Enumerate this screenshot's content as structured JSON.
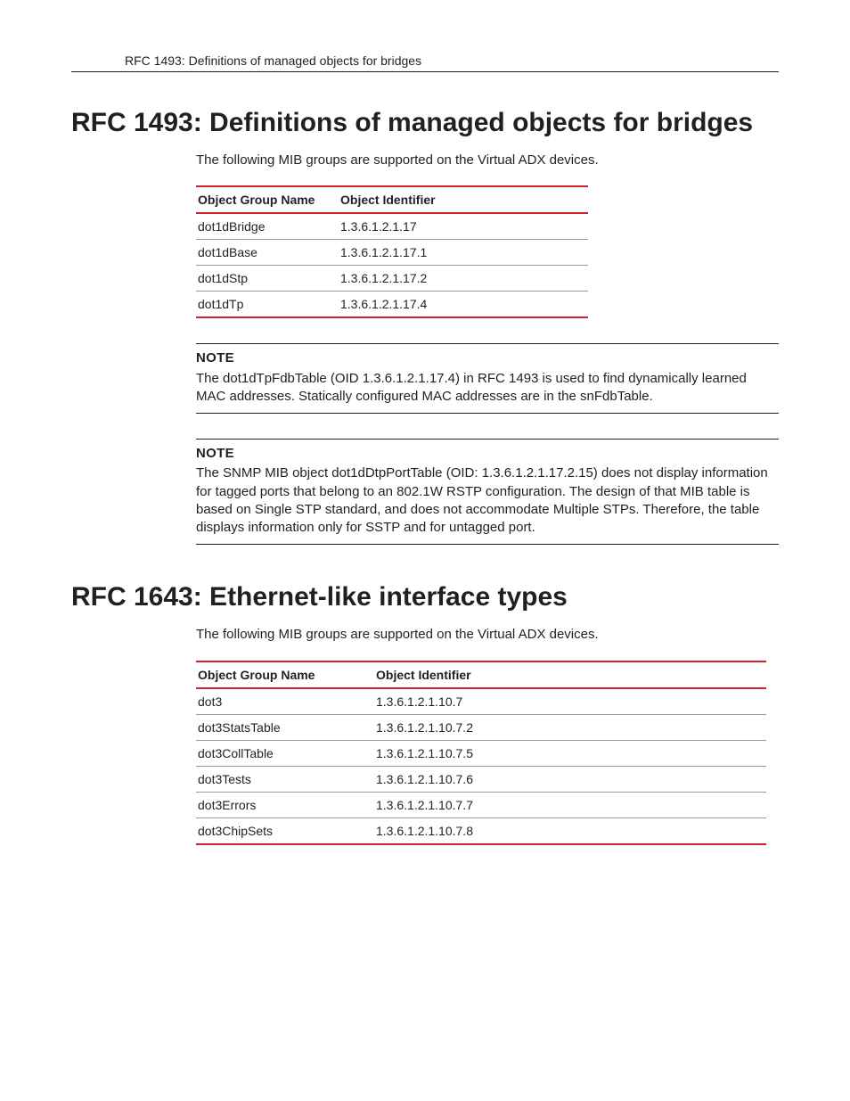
{
  "running_header": "RFC 1493: Definitions of managed objects for bridges",
  "section1": {
    "title": "RFC 1493: Definitions of managed objects for bridges",
    "intro": "The following MIB groups are supported on the Virtual ADX devices.",
    "table": {
      "col1": "Object Group Name",
      "col2": "Object Identifier",
      "rows": [
        {
          "name": "dot1dBridge",
          "oid": "1.3.6.1.2.1.17"
        },
        {
          "name": "dot1dBase",
          "oid": "1.3.6.1.2.1.17.1"
        },
        {
          "name": "dot1dStp",
          "oid": "1.3.6.1.2.1.17.2"
        },
        {
          "name": "dot1dTp",
          "oid": "1.3.6.1.2.1.17.4"
        }
      ]
    },
    "note1": {
      "label": "NOTE",
      "text": "The dot1dTpFdbTable (OID 1.3.6.1.2.1.17.4) in RFC 1493 is used to find dynamically learned MAC addresses. Statically configured MAC addresses are in the snFdbTable."
    },
    "note2": {
      "label": "NOTE",
      "text": "The SNMP MIB object dot1dDtpPortTable (OID: 1.3.6.1.2.1.17.2.15) does not display information for tagged ports that belong to an 802.1W RSTP configuration. The design of that MIB table is based on Single STP standard, and does not accommodate Multiple STPs. Therefore, the table displays information only for SSTP and for untagged port."
    }
  },
  "section2": {
    "title": "RFC 1643: Ethernet-like interface types",
    "intro": "The following MIB groups are supported on the Virtual ADX devices.",
    "table": {
      "col1": "Object Group Name",
      "col2": "Object Identifier",
      "rows": [
        {
          "name": "dot3",
          "oid": "1.3.6.1.2.1.10.7"
        },
        {
          "name": "dot3StatsTable",
          "oid": "1.3.6.1.2.1.10.7.2"
        },
        {
          "name": "dot3CollTable",
          "oid": "1.3.6.1.2.1.10.7.5"
        },
        {
          "name": "dot3Tests",
          "oid": "1.3.6.1.2.1.10.7.6"
        },
        {
          "name": "dot3Errors",
          "oid": "1.3.6.1.2.1.10.7.7"
        },
        {
          "name": "dot3ChipSets",
          "oid": "1.3.6.1.2.1.10.7.8"
        }
      ]
    }
  }
}
